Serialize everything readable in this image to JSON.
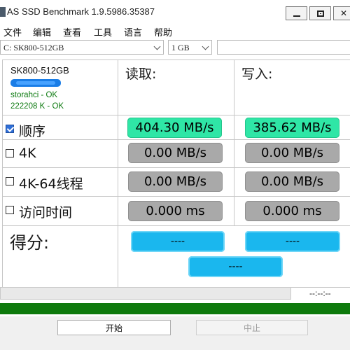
{
  "window": {
    "title": "AS SSD Benchmark 1.9.5986.35387"
  },
  "menu": [
    "文件",
    "编辑",
    "查看",
    "工具",
    "语言",
    "帮助"
  ],
  "selectors": {
    "drive": "C: SK800-512GB",
    "size": "1 GB",
    "extra": ""
  },
  "drive_info": {
    "name": "SK800-512GB",
    "status_1": "storahci - OK",
    "status_2": "222208 K - OK"
  },
  "columns": {
    "read": "读取:",
    "write": "写入:"
  },
  "rows": [
    {
      "label": "顺序",
      "checked": true,
      "read": "404.30 MB/s",
      "write": "385.62 MB/s"
    },
    {
      "label": "4K",
      "checked": false,
      "read": "0.00 MB/s",
      "write": "0.00 MB/s"
    },
    {
      "label": "4K-64线程",
      "checked": false,
      "read": "0.00 MB/s",
      "write": "0.00 MB/s"
    },
    {
      "label": "访问时间",
      "checked": false,
      "read": "0.000 ms",
      "write": "0.000 ms"
    }
  ],
  "score": {
    "label": "得分:",
    "read": "----",
    "write": "----",
    "total": "----"
  },
  "progress": {
    "time": "--:--:--",
    "fraction": 0
  },
  "buttons": {
    "start": "开始",
    "stop": "中止"
  },
  "colors": {
    "green_result": "#2fe6a6",
    "gray_result": "#a9a9a9",
    "score_blue": "#1ab7ee",
    "status_green": "#0e7a0d"
  }
}
